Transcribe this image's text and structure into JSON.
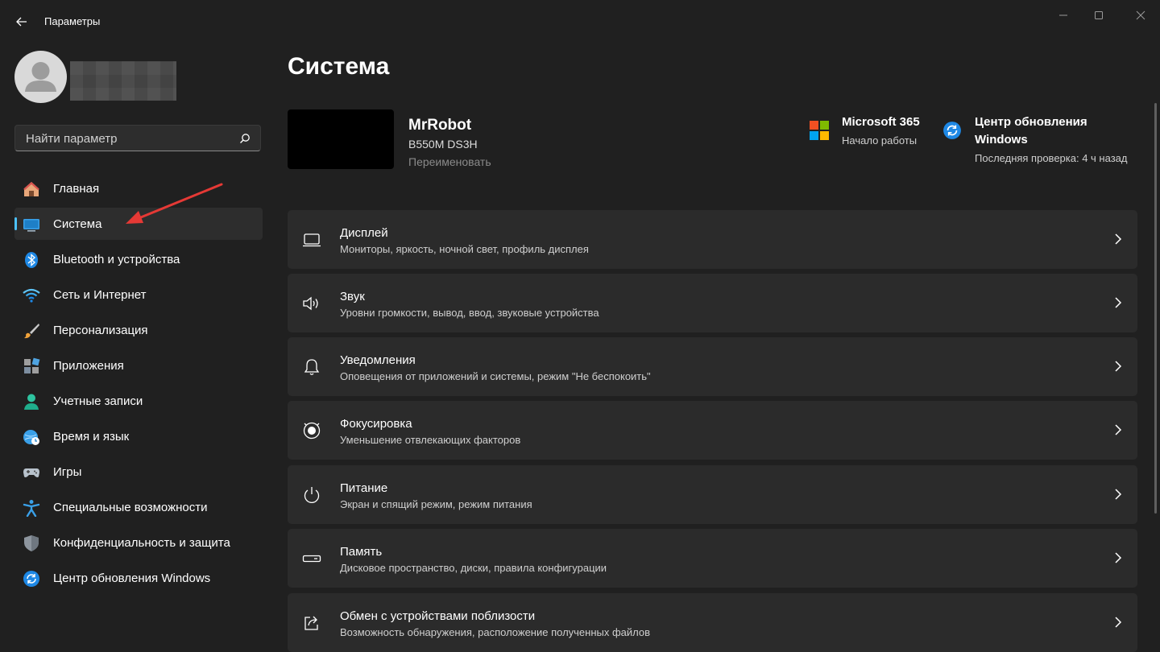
{
  "window": {
    "app_title": "Параметры"
  },
  "profile": {
    "name": ""
  },
  "search": {
    "placeholder": "Найти параметр"
  },
  "sidebar": {
    "items": [
      {
        "label": "Главная",
        "icon": "home-icon"
      },
      {
        "label": "Система",
        "icon": "monitor-icon",
        "active": true
      },
      {
        "label": "Bluetooth и устройства",
        "icon": "bluetooth-icon"
      },
      {
        "label": "Сеть и Интернет",
        "icon": "wifi-icon"
      },
      {
        "label": "Персонализация",
        "icon": "paintbrush-icon"
      },
      {
        "label": "Приложения",
        "icon": "apps-icon"
      },
      {
        "label": "Учетные записи",
        "icon": "account-icon"
      },
      {
        "label": "Время и язык",
        "icon": "globe-clock-icon"
      },
      {
        "label": "Игры",
        "icon": "gamepad-icon"
      },
      {
        "label": "Специальные возможности",
        "icon": "accessibility-icon"
      },
      {
        "label": "Конфиденциальность и защита",
        "icon": "shield-icon"
      },
      {
        "label": "Центр обновления Windows",
        "icon": "windows-update-icon"
      }
    ]
  },
  "main": {
    "page_title": "Система",
    "device": {
      "name": "MrRobot",
      "model": "B550M DS3H",
      "rename_label": "Переименовать"
    },
    "ms365": {
      "title": "Microsoft 365",
      "subtitle": "Начало работы"
    },
    "update": {
      "title_line1": "Центр обновления",
      "title_line2": "Windows",
      "subtitle": "Последняя проверка: 4 ч назад"
    },
    "cards": [
      {
        "title": "Дисплей",
        "subtitle": "Мониторы, яркость, ночной свет, профиль дисплея",
        "icon": "display-icon"
      },
      {
        "title": "Звук",
        "subtitle": "Уровни громкости, вывод, ввод, звуковые устройства",
        "icon": "speaker-icon"
      },
      {
        "title": "Уведомления",
        "subtitle": "Оповещения от приложений и системы, режим \"Не беспокоить\"",
        "icon": "bell-icon"
      },
      {
        "title": "Фокусировка",
        "subtitle": "Уменьшение отвлекающих факторов",
        "icon": "focus-icon"
      },
      {
        "title": "Питание",
        "subtitle": "Экран и спящий режим, режим питания",
        "icon": "power-icon"
      },
      {
        "title": "Память",
        "subtitle": "Дисковое пространство, диски, правила конфигурации",
        "icon": "storage-icon"
      },
      {
        "title": "Обмен с устройствами поблизости",
        "subtitle": "Возможность обнаружения, расположение полученных файлов",
        "icon": "share-icon"
      }
    ]
  },
  "colors": {
    "background": "#202020",
    "card": "#2b2b2b",
    "accent": "#4cc2ff",
    "annotation_arrow": "#e53935"
  }
}
